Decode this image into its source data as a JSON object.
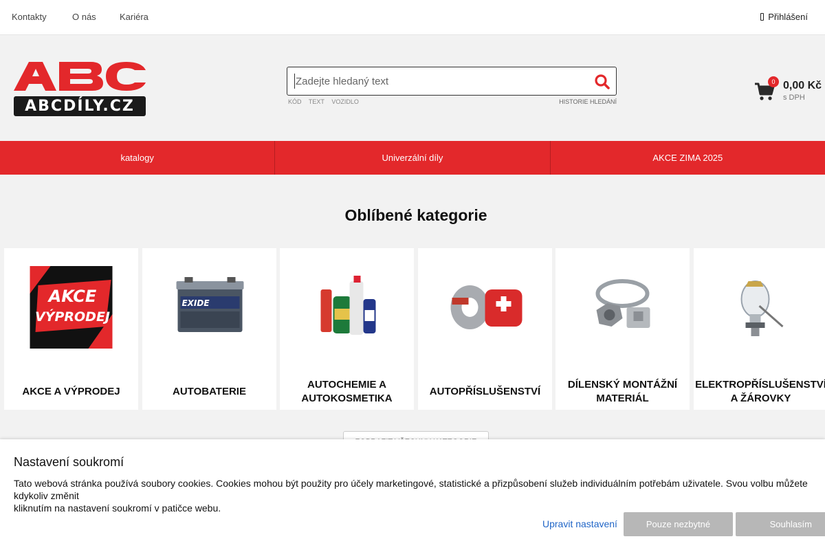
{
  "topbar": {
    "links": [
      "Kontakty",
      "O nás",
      "Kariéra"
    ],
    "login_label": "Přihlášení"
  },
  "logo": {
    "top_text": "ABC",
    "bottom_text": "ABCDÍLY.CZ"
  },
  "search": {
    "placeholder": "Zadejte hledaný text",
    "modes": [
      "KÓD",
      "TEXT",
      "VOZIDLO"
    ],
    "history_label": "HISTORIE HLEDÁNÍ"
  },
  "cart": {
    "count": "0",
    "price": "0,00 Kč",
    "vat_note": "s DPH"
  },
  "nav": {
    "items": [
      "katalogy",
      "Univerzální díly",
      "AKCE ZIMA 2025"
    ]
  },
  "categories": {
    "title": "Oblíbené kategorie",
    "items": [
      {
        "label": "AKCE A VÝPRODEJ",
        "image_text_1": "AKCE",
        "image_text_2": "VÝPRODEJ"
      },
      {
        "label": "AUTOBATERIE",
        "image_text_1": "EXIDE"
      },
      {
        "label": "AUTOCHEMIE A AUTOKOSMETIKA"
      },
      {
        "label": "AUTOPŘÍSLUŠENSTVÍ"
      },
      {
        "label": "DÍLENSKÝ MONTÁŽNÍ MATERIÁL"
      },
      {
        "label": "ELEKTROPŘÍSLUŠENSTVÍ A ŽÁROVKY"
      }
    ],
    "show_all_label": "ZOBRAZIT VŠECHNY KATEGORIE"
  },
  "cookie": {
    "title": "Nastavení soukromí",
    "text": "Tato webová stránka používá soubory cookies. Cookies mohou být použity pro účely marketingové, statistické a přizpůsobení služeb individuálním potřebám uživatele. Svou volbu můžete kdykoliv změnit\nkliknutím na nastavení soukromí v patičce webu.",
    "edit_label": "Upravit nastavení",
    "necessary_label": "Pouze nezbytné",
    "agree_label": "Souhlasím"
  },
  "colors": {
    "brand_red": "#e3282b",
    "logo_dark": "#1a1a1a",
    "link_blue": "#2166c7"
  }
}
